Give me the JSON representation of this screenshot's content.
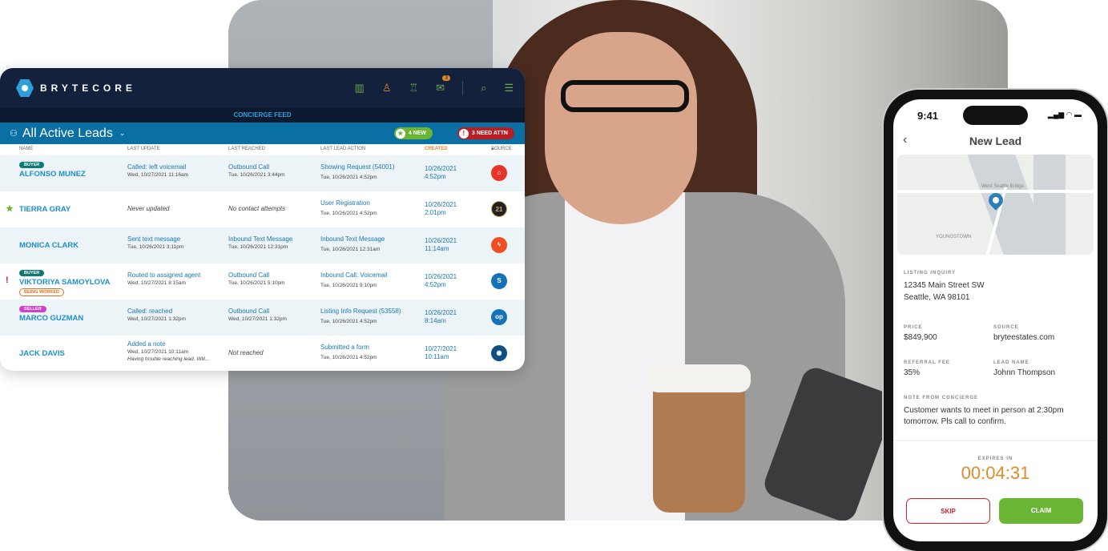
{
  "dashboard": {
    "brand": "BRYTECORE",
    "mail_badge": "3",
    "concierge_label": "CONCIERGE FEED",
    "title": "All Active Leads",
    "new_pill": "4 NEW",
    "attn_pill": "3 NEED ATTN",
    "columns": [
      "NAME",
      "LAST UPDATE",
      "LAST REACHED",
      "LAST LEAD ACTION",
      "CREATED",
      "SOURCE"
    ],
    "colors": {
      "header": "#13213d",
      "bar": "#0a6fa3",
      "created_header": "#e08b2a",
      "new": "#6bb536",
      "attn": "#b81e24"
    },
    "rows": [
      {
        "tag": "BUYER",
        "name": "ALFONSO MUNEZ",
        "update": "Called: left voicemail",
        "update_time": "Wed, 10/27/2021 11:16am",
        "reached": "Outbound Call",
        "reached_time": "Tue, 10/26/2021 3:44pm",
        "action": "Showing Request (54001)",
        "action_time": "Tue, 10/26/2021 4:52pm",
        "created_date": "10/26/2021",
        "created_time": "4:52pm",
        "source_icon": "house-icon"
      },
      {
        "flag": "★",
        "name": "TIERRA GRAY",
        "update": "Never updated",
        "reached": "No contact attempts",
        "action": "User Registration",
        "action_time": "Tue, 10/26/2021 4:52pm",
        "created_date": "10/26/2021",
        "created_time": "2:01pm",
        "source_icon": "century21-icon",
        "source_text": "21"
      },
      {
        "name": "MONICA CLARK",
        "update": "Sent text message",
        "update_time": "Tue, 10/26/2021 3:11pm",
        "reached": "Inbound Text Message",
        "reached_time": "Tue, 10/26/2021 12:31pm",
        "action": "Inbound Text Message",
        "action_time": "Tue, 10/26/2021 12:31am",
        "created_date": "10/26/2021",
        "created_time": "11:14am",
        "source_icon": "bolt-icon"
      },
      {
        "flag": "!",
        "tag": "BUYER",
        "name": "VIKTORIYA SAMOYLOVA",
        "status": "BEING WORKED",
        "update": "Routed to assigned agent",
        "update_time": "Wed, 10/27/2021 8:15am",
        "reached": "Outbound Call",
        "reached_time": "Tue, 10/26/2021 5:10pm",
        "action": "Inbound Call: Voicemail",
        "action_time": "Tue, 10/26/2021 9:10pm",
        "created_date": "10/26/2021",
        "created_time": "4:52pm",
        "source_icon": "s-logo-icon"
      },
      {
        "tag": "SELLER",
        "name": "MARCO GUZMAN",
        "update": "Called: reached",
        "update_time": "Wed, 10/27/2021 1:32pm",
        "reached": "Outbound Call",
        "reached_time": "Wed, 10/27/2021 1:32pm",
        "action": "Listing Info Request (53558)",
        "action_time": "Tue, 10/26/2021 4:52pm",
        "created_date": "10/26/2021",
        "created_time": "8:14am",
        "source_icon": "op-logo-icon",
        "source_text": "op"
      },
      {
        "name": "JACK DAVIS",
        "update": "Added a note",
        "update_time": "Wed, 10/27/2021 10:11am",
        "update_note": "Having trouble reaching lead. Will...",
        "reached": "Not reached",
        "action": "Submitted a form",
        "action_time": "Tue, 10/26/2021 4:52pm",
        "created_date": "10/27/2021",
        "created_time": "10:11am",
        "source_icon": "brytecore-icon"
      }
    ]
  },
  "phone": {
    "time": "9:41",
    "title": "New Lead",
    "map_labels": [
      "West Seattle Bridge",
      "YOUNGSTOWN"
    ],
    "listing_label": "LISTING INQUIRY",
    "address1": "12345 Main Street SW",
    "address2": "Seattle, WA 98101",
    "price_label": "PRICE",
    "price": "$849,900",
    "source_label": "SOURCE",
    "source": "bryteestates.com",
    "fee_label": "REFERRAL FEE",
    "fee": "35%",
    "lead_label": "LEAD NAME",
    "lead": "Johnn Thompson",
    "note_label": "NOTE FROM CONCIERGE",
    "note": "Customer wants to meet in person at 2:30pm tomorrow. Pls call to confirm.",
    "expires_label": "EXPIRES IN",
    "countdown": "00:04:31",
    "skip": "SKIP",
    "claim": "CLAIM",
    "colors": {
      "countdown": "#e08b2a",
      "skip": "#d5202a",
      "claim": "#6bb536"
    }
  }
}
